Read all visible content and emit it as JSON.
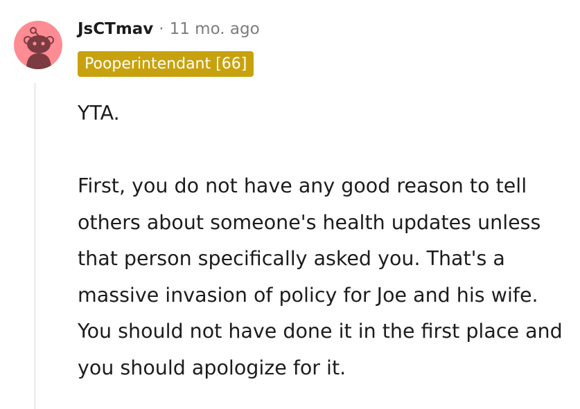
{
  "comment": {
    "author": "JsCTmav",
    "separator": "·",
    "time_ago": "11 mo. ago",
    "flair": "Pooperintendant [66]",
    "paragraphs": [
      "YTA.",
      "First, you do not have any good reason to tell others about someone's health updates unless that person specifically asked you. That's a massive invasion of policy for Joe and his wife. You should not have done it in the first place and you should apologize for it."
    ],
    "avatar_icon": "snoo-avatar-icon"
  },
  "colors": {
    "avatar_bg": "#ff8b93",
    "flair_bg": "#c8a20e",
    "meta_text": "#7c7c7c",
    "thread_line": "#edeff1"
  }
}
